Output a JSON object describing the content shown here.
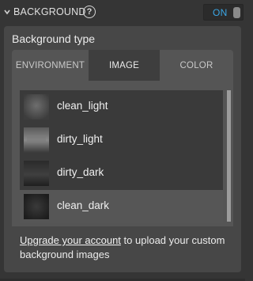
{
  "header": {
    "title": "BACKGROUND",
    "collapse_icon": "chevron-down-icon",
    "help_icon": "help-icon",
    "help_glyph": "?",
    "toggle_label": "ON",
    "accent_color": "#3aa7e6"
  },
  "panel": {
    "label": "Background type",
    "tabs": [
      {
        "label": "ENVIRONMENT",
        "active": false
      },
      {
        "label": "IMAGE",
        "active": true
      },
      {
        "label": "COLOR",
        "active": false
      }
    ],
    "images": [
      {
        "label": "clean_light",
        "selected": false
      },
      {
        "label": "dirty_light",
        "selected": false
      },
      {
        "label": "dirty_dark",
        "selected": false
      },
      {
        "label": "clean_dark",
        "selected": true
      }
    ],
    "upgrade": {
      "link_text": "Upgrade your account",
      "rest_text": " to upload your custom background images"
    }
  }
}
